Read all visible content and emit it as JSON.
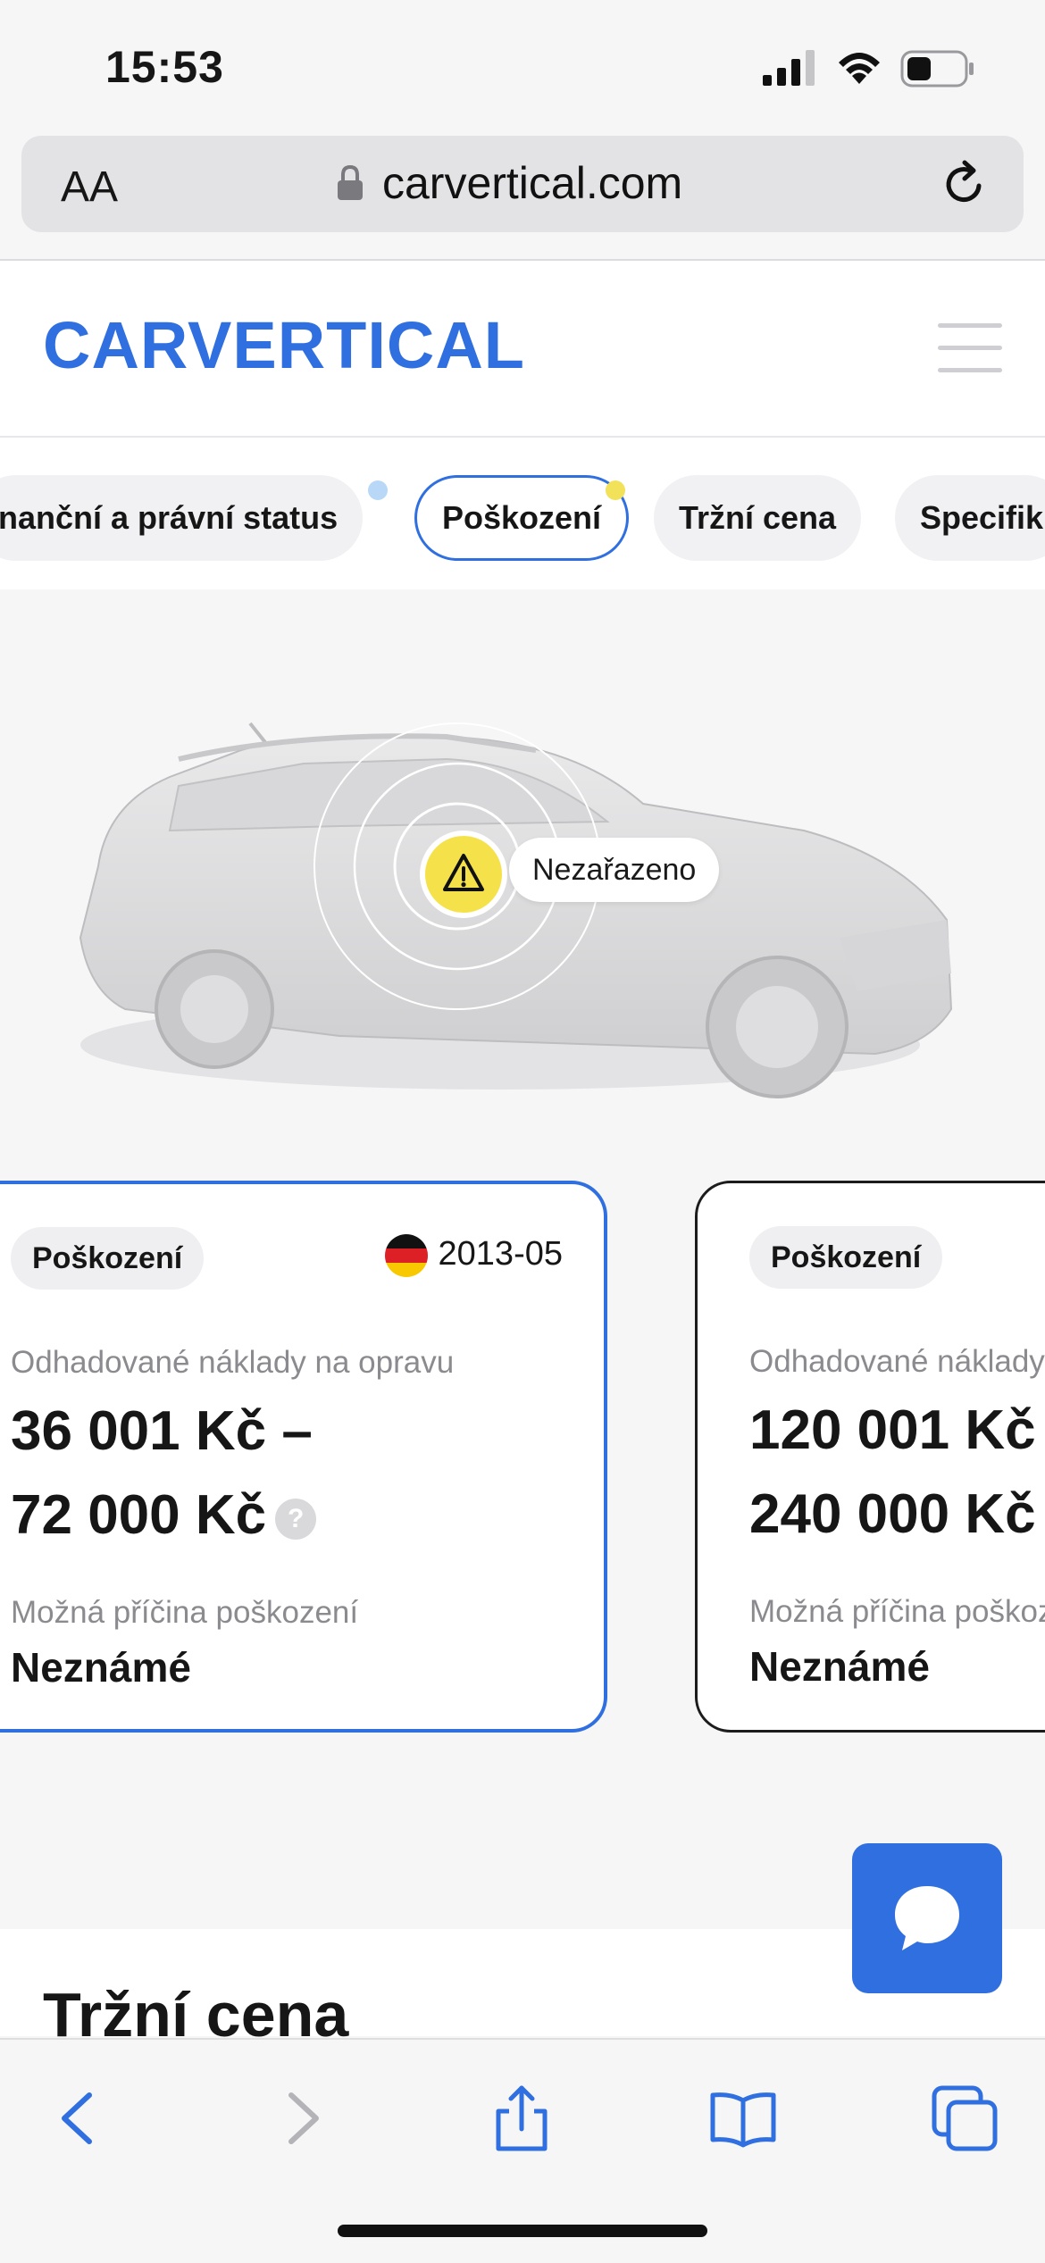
{
  "status_bar": {
    "time": "15:53"
  },
  "browser": {
    "aa_label": "AA",
    "url": "carvertical.com"
  },
  "site": {
    "logo": "CARVERTICAL"
  },
  "tabs": [
    {
      "label": "nanční a právní status",
      "dot_color": "#b9d7f7"
    },
    {
      "label": "Poškození",
      "dot_color": "#f2e25a",
      "active": true
    },
    {
      "label": "Tržní cena"
    },
    {
      "label": "Specifik"
    }
  ],
  "hero": {
    "tag": "Nezařazeno"
  },
  "cards": [
    {
      "badge": "Poškození",
      "date": "2013-05",
      "cost_label": "Odhadované náklady na opravu",
      "amount_line1": "36 001 Kč –",
      "amount_line2": "72 000 Kč",
      "cause_label": "Možná příčina poškození",
      "cause": "Neznámé"
    },
    {
      "badge": "Poškození",
      "cost_label": "Odhadované náklady na opravu",
      "amount_line1": "120 001 Kč –",
      "amount_line2": "240 000 Kč",
      "cause_label": "Možná příčina poškození",
      "cause": "Neznámé"
    }
  ],
  "section": {
    "title": "Tržní cena"
  },
  "colors": {
    "accent": "#2f6fe0",
    "warning": "#f5e24b"
  }
}
